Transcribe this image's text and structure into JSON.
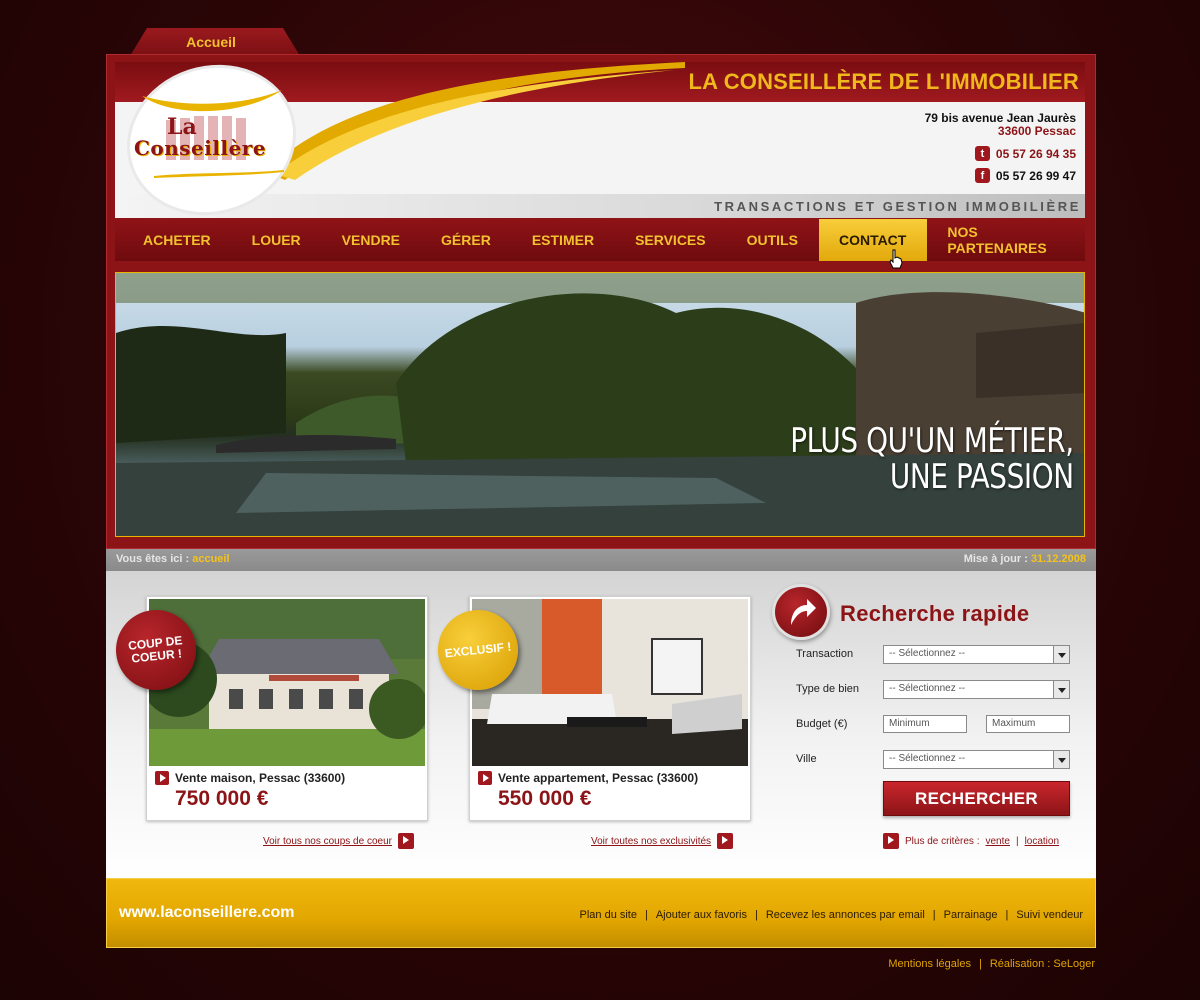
{
  "top_tab": {
    "label": "Accueil"
  },
  "header": {
    "site_title": "LA CONSEILLÈRE DE L'IMMOBILIER",
    "tagline": "TRANSACTIONS ET GESTION IMMOBILIÈRE",
    "address_street": "79 bis avenue Jean Jaurès",
    "address_city": "33600 Pessac",
    "phone": "05 57 26 94 35",
    "phone_badge": "t",
    "fax": "05 57 26 99 47",
    "fax_badge": "f"
  },
  "logo": {
    "line1": "La",
    "line2": "Conseillère"
  },
  "nav": {
    "items": [
      {
        "label": "ACHETER"
      },
      {
        "label": "LOUER"
      },
      {
        "label": "VENDRE"
      },
      {
        "label": "GÉRER"
      },
      {
        "label": "ESTIMER"
      },
      {
        "label": "SERVICES"
      },
      {
        "label": "OUTILS"
      },
      {
        "label": "CONTACT"
      },
      {
        "label": "NOS PARTENAIRES"
      }
    ],
    "active": "CONTACT"
  },
  "hero": {
    "line1": "PLUS QU'UN MÉTIER,",
    "line2": "UNE PASSION"
  },
  "breadcrumb": {
    "prefix": "Vous êtes ici :",
    "current": "accueil",
    "update_label": "Mise à jour :",
    "update_date": "31.12.2008"
  },
  "cards": [
    {
      "sticker": "COUP DE COEUR !",
      "title": "Vente maison, Pessac (33600)",
      "price": "750 000 €",
      "link": "Voir tous nos coups de coeur"
    },
    {
      "sticker": "EXCLUSIF !",
      "title": "Vente appartement, Pessac (33600)",
      "price": "550 000 €",
      "link": "Voir toutes nos exclusivités"
    }
  ],
  "search": {
    "title": "Recherche rapide",
    "transaction_label": "Transaction",
    "transaction_value": "-- Sélectionnez --",
    "type_label": "Type de bien",
    "type_value": "-- Sélectionnez --",
    "budget_label": "Budget (€)",
    "budget_min_placeholder": "Minimum",
    "budget_max_placeholder": "Maximum",
    "ville_label": "Ville",
    "ville_value": "-- Sélectionnez --",
    "button": "RECHERCHER",
    "more_prefix": "Plus de critères :",
    "more_vente": "vente",
    "more_location": "location"
  },
  "footer": {
    "url": "www.laconseillere.com",
    "links": [
      "Plan du site",
      "Ajouter aux favoris",
      "Recevez les annonces par email",
      "Parrainage",
      "Suivi vendeur"
    ]
  },
  "legal": {
    "mentions": "Mentions légales",
    "realisation": "Réalisation : SeLoger"
  },
  "colors": {
    "brand_red": "#8c1417",
    "brand_gold": "#f0b81c"
  }
}
